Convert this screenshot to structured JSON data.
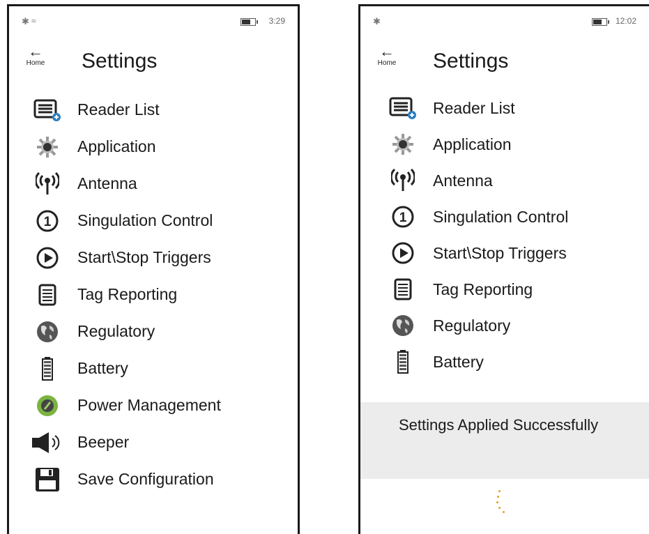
{
  "left_screen": {
    "status": {
      "time": "3:29",
      "bluetooth_icon": "bluetooth-icon",
      "signal_icon": "signal-icon"
    },
    "header": {
      "back_label": "Home",
      "title": "Settings"
    },
    "menu": [
      {
        "label": "Reader List",
        "icon": "reader-list-icon"
      },
      {
        "label": "Application",
        "icon": "gear-icon"
      },
      {
        "label": "Antenna",
        "icon": "antenna-icon"
      },
      {
        "label": "Singulation Control",
        "icon": "singulation-icon"
      },
      {
        "label": "Start\\Stop Triggers",
        "icon": "play-icon"
      },
      {
        "label": "Tag Reporting",
        "icon": "tag-report-icon"
      },
      {
        "label": "Regulatory",
        "icon": "globe-icon"
      },
      {
        "label": "Battery",
        "icon": "battery-icon"
      },
      {
        "label": "Power Management",
        "icon": "power-management-icon"
      },
      {
        "label": "Beeper",
        "icon": "speaker-icon"
      },
      {
        "label": "Save Configuration",
        "icon": "save-icon"
      }
    ]
  },
  "right_screen": {
    "status": {
      "time": "12:02",
      "bluetooth_icon": "bluetooth-icon"
    },
    "header": {
      "back_label": "Home",
      "title": "Settings"
    },
    "menu": [
      {
        "label": "Reader List",
        "icon": "reader-list-icon"
      },
      {
        "label": "Application",
        "icon": "gear-icon"
      },
      {
        "label": "Antenna",
        "icon": "antenna-icon"
      },
      {
        "label": "Singulation Control",
        "icon": "singulation-icon"
      },
      {
        "label": "Start\\Stop Triggers",
        "icon": "play-icon"
      },
      {
        "label": "Tag Reporting",
        "icon": "tag-report-icon"
      },
      {
        "label": "Regulatory",
        "icon": "globe-icon"
      },
      {
        "label": "Battery",
        "icon": "battery-icon"
      }
    ],
    "toast": {
      "message": "Settings Applied Successfully"
    }
  },
  "colors": {
    "accent_spinner": "#e6a020",
    "toast_bg": "#ececec",
    "power_green": "#7cb342"
  }
}
